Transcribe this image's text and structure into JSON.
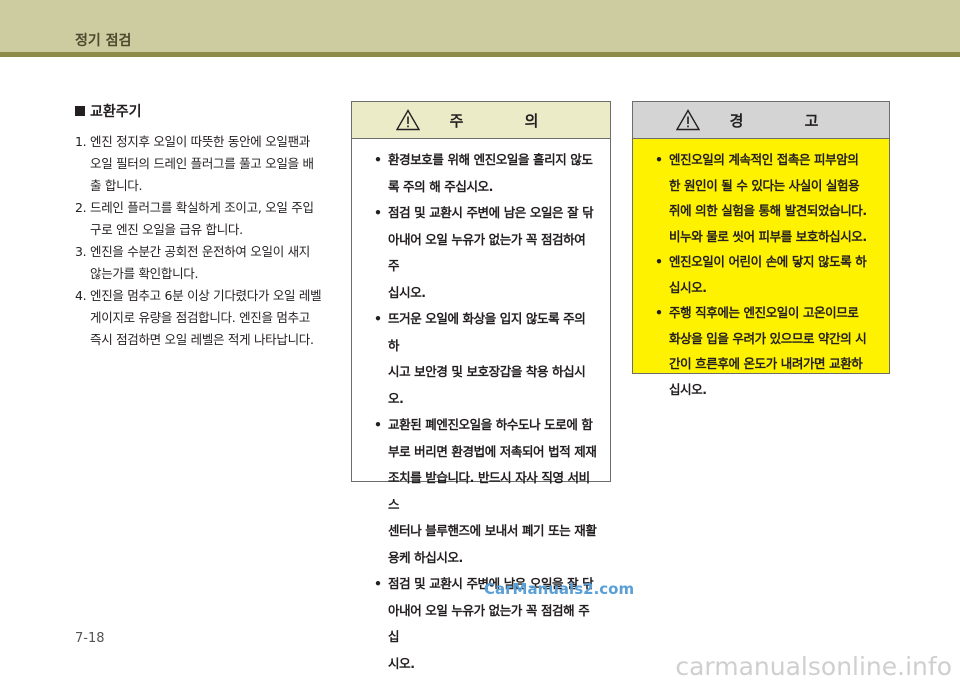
{
  "header": {
    "title": "정기 점검"
  },
  "left": {
    "heading": "교환주기",
    "steps": [
      {
        "num": "1.",
        "lines": [
          "엔진 정지후 오일이 따뜻한 동안에 오일팬과",
          "오일 필터의 드레인 플러그를 풀고 오일을 배",
          "출 합니다."
        ]
      },
      {
        "num": "2.",
        "lines": [
          "드레인 플러그를 확실하게 조이고, 오일 주입",
          "구로 엔진 오일을 급유 합니다."
        ]
      },
      {
        "num": "3.",
        "lines": [
          "엔진을 수분간 공회전 운전하여 오일이 새지",
          "않는가를 확인합니다."
        ]
      },
      {
        "num": "4.",
        "lines": [
          "엔진을 멈추고 6분 이상 기다렸다가 오일 레벨",
          "게이지로 유량을 점검합니다. 엔진을 멈추고",
          "즉시 점검하면 오일 레벨은 적게 나타납니다."
        ]
      }
    ]
  },
  "caution": {
    "title": "주 의",
    "items": [
      {
        "lines": [
          "환경보호를 위해 엔진오일을 흘리지 않도",
          "록 주의 해 주십시오."
        ]
      },
      {
        "lines": [
          "점검 및 교환시 주변에 남은 오일은 잘 닦",
          "아내어 오일 누유가 없는가 꼭 점검하여 주",
          "십시오."
        ]
      },
      {
        "lines": [
          "뜨거운 오일에 화상을 입지 않도록 주의 하",
          "시고 보안경 및 보호장갑을 착용 하십시오."
        ]
      },
      {
        "lines": [
          "교환된 폐엔진오일을 하수도나 도로에 함",
          "부로 버리면 환경법에 저촉되어 법적 제재",
          "조치를 받습니다. 반드시 자사 직영 서비스",
          "센터나 블루핸즈에 보내서 폐기 또는 재활",
          "용케 하십시오."
        ]
      },
      {
        "lines": [
          "점검 및 교환시 주변에 남은 오일을 잘 닦",
          "아내어 오일 누유가 없는가 꼭 점검해 주십",
          "시오."
        ]
      }
    ]
  },
  "warning": {
    "title": "경 고",
    "items": [
      {
        "lines": [
          "엔진오일의 계속적인 접촉은 피부암의",
          "한 원인이 될 수 있다는 사실이 실험용",
          "쥐에 의한 실험을 통해 발견되었습니다.",
          "비누와 물로 씻어 피부를 보호하십시오."
        ]
      },
      {
        "lines": [
          "엔진오일이 어린이 손에 닿지 않도록 하",
          "십시오."
        ]
      },
      {
        "lines": [
          "주행 직후에는 엔진오일이 고온이므로",
          "화상을 입을 우려가 있으므로 약간의 시",
          "간이 흐른후에 온도가 내려가면 교환하",
          "십시오."
        ]
      }
    ]
  },
  "watermark": "CarManuals2.com",
  "page_number": "7-18",
  "footer_watermark": "carmanualsonline.info",
  "colors": {
    "header_band": "#cdcba0",
    "header_line": "#8e8a4a",
    "caution_head": "#ecebc8",
    "warning_body": "#fff200",
    "warning_head": "#d4d4d4"
  }
}
